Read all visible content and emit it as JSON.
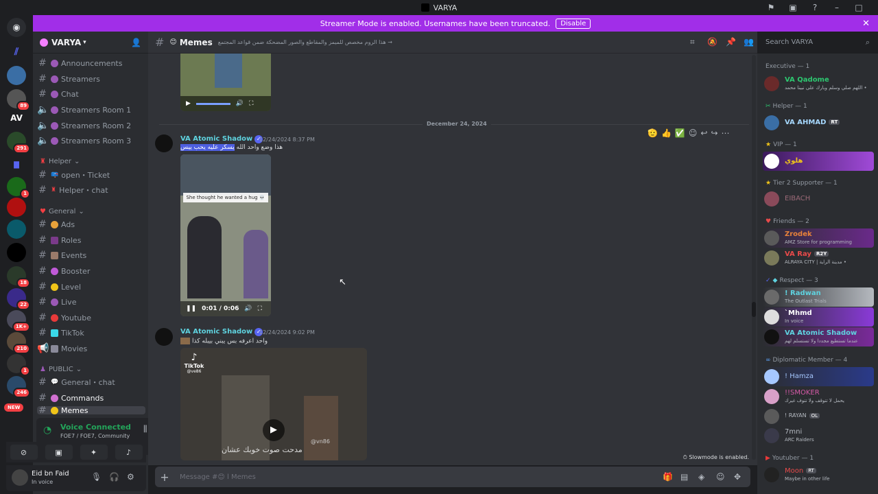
{
  "window": {
    "title": "VARYA"
  },
  "banner": {
    "text": "Streamer Mode is enabled. Usernames have been truncated.",
    "button": "Disable"
  },
  "rail": {
    "badges": [
      "89",
      "291",
      "1",
      "18",
      "22",
      "1K+",
      "210",
      "1",
      "246"
    ],
    "new_label": "NEW",
    "av_label": "AV"
  },
  "sidebar": {
    "guild_name": "VARYA",
    "channels": [
      {
        "label": "Announcements",
        "type": "text"
      },
      {
        "label": "Streamers",
        "type": "text"
      },
      {
        "label": "Chat",
        "type": "text"
      },
      {
        "label": "Streamers Room 1",
        "type": "voice"
      },
      {
        "label": "Streamers Room 2",
        "type": "voice"
      },
      {
        "label": "Streamers Room 3",
        "type": "voice"
      }
    ],
    "cat_helper": "Helper",
    "helper_channels": [
      {
        "label": "open・Ticket"
      },
      {
        "label": "Helper・chat"
      }
    ],
    "cat_general": "General",
    "general_channels": [
      {
        "label": "Ads"
      },
      {
        "label": "Roles"
      },
      {
        "label": "Events"
      },
      {
        "label": "Booster"
      },
      {
        "label": "Level"
      },
      {
        "label": "Live"
      },
      {
        "label": "Youtube"
      },
      {
        "label": "TikTok"
      },
      {
        "label": "Movies"
      }
    ],
    "cat_public": "PUBLIC",
    "public_channels": [
      {
        "label": "General・chat"
      },
      {
        "label": "Commands"
      },
      {
        "label": "Memes"
      }
    ],
    "voice": {
      "title": "Voice Connected",
      "sub": "FOE7 / FOE7, Community"
    },
    "user": {
      "name": "Eid bn Faid",
      "status": "In voice"
    }
  },
  "chat": {
    "channel": "Memes",
    "topic": "→ هذا الروم مخصص للميمز والمقاطع والصور المضحكة ضمن قواعد المجتمع",
    "search_placeholder": "Search VARYA",
    "date_divider": "December 24, 2024",
    "messages": [
      {
        "author": "VA  Atomic Shadow",
        "time": "12/24/2024 8:37 PM",
        "text_plain": "هذا وضع واحد الله ",
        "text_hl": "يسكر عليه يحب ييس",
        "video_caption": "She thought he wanted a hug 💀",
        "video_time": "0:01 / 0:06"
      },
      {
        "author": "VA  Atomic Shadow",
        "time": "12/24/2024 9:02 PM",
        "text": "واحد اعرفه بس يبني بيبله كذا",
        "tiktok": "TikTok",
        "tiktok_user": "@ve86",
        "overlay_text": "مدحت صوت خوبك عشان",
        "watermark": "@vn86"
      }
    ],
    "slowmode": "Slowmode is enabled.",
    "composer_placeholder": "Message #😊 ا Memes"
  },
  "members": {
    "groups": [
      {
        "title": "Executive — 1"
      },
      {
        "title": "Helper — 1"
      },
      {
        "title": "VIP — 1"
      },
      {
        "title": "Tier 2 Supporter — 1"
      },
      {
        "title": "Friends — 2"
      },
      {
        "title": "Respect — 3"
      },
      {
        "title": "Diplomatic Member — 4"
      },
      {
        "title": "Youtuber — 1"
      }
    ],
    "list": [
      {
        "name": "VA Qadome",
        "status": "اللهم صلي وسلم وبارك على نبينا محمد •",
        "color": "#2dc770"
      },
      {
        "name": "VA AHMAD",
        "tag": "RT",
        "status": "",
        "color": "#a6d8ff"
      },
      {
        "name": "هلوي",
        "status": "",
        "color": "#f0c419"
      },
      {
        "name": "EIBACH",
        "status": "",
        "color": "#9c6a78"
      },
      {
        "name": "Zrodek",
        "status": "AMZ Store for programming",
        "color": "#e8823a"
      },
      {
        "name": "VA Ray",
        "tag": "R2Y",
        "status": "ALRAYA CITY | مدينة الراية •",
        "color": "#e84a4a"
      },
      {
        "name": "! Radwan",
        "status": "The Outlast Trials",
        "color": "#5fd3e0"
      },
      {
        "name": "`Mhmd",
        "status": "In voice",
        "color": "#ffffff"
      },
      {
        "name": "VA Atomic Shadow",
        "status": "عندما تستطيع مجددا ولا تستسلم لهم",
        "color": "#5fd3e0"
      },
      {
        "name": "! Hamza",
        "status": "",
        "color": "#a6c8ff"
      },
      {
        "name": "!!SMOKER",
        "status": "يحمل لا تتوقف ولا تتوف غيرك",
        "color": "#d65aa8"
      },
      {
        "name": "! RAYAN",
        "tag": "OL",
        "status": "",
        "color": "#b5bac1"
      },
      {
        "name": "7mni",
        "status": "ARC Raiders",
        "color": "#b5bac1"
      },
      {
        "name": "Moon",
        "tag": "RT",
        "status": "Maybe in other life",
        "color": "#e84a4a"
      }
    ]
  }
}
